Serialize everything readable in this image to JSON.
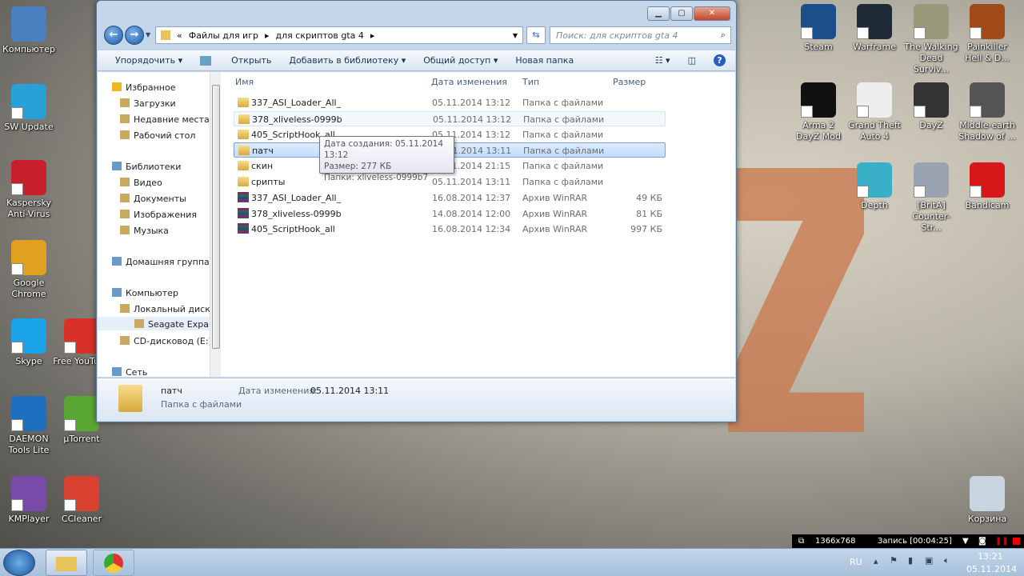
{
  "desktop": {
    "left_icons": [
      {
        "label": "Компьютер",
        "icon": "computer-icon",
        "color": "#4a7fc0"
      },
      {
        "label": "SW Update",
        "icon": "sw-update-icon",
        "color": "#29a0d8"
      },
      {
        "label": "Kaspersky Anti-Virus",
        "icon": "kaspersky-icon",
        "color": "#c8202a"
      },
      {
        "label": "Google Chrome",
        "icon": "chrome-icon",
        "color": "#e0a020"
      },
      {
        "label": "Skype",
        "icon": "skype-icon",
        "color": "#1aa3e6"
      },
      {
        "label": "Free YouTube",
        "icon": "download-icon",
        "color": "#d9302a"
      },
      {
        "label": "DAEMON Tools Lite",
        "icon": "daemon-tools-icon",
        "color": "#1e6fc0"
      },
      {
        "label": "µTorrent",
        "icon": "utorrent-icon",
        "color": "#5aa632"
      },
      {
        "label": "KMPlayer",
        "icon": "kmplayer-icon",
        "color": "#7a4aa8"
      },
      {
        "label": "CCleaner",
        "icon": "ccleaner-icon",
        "color": "#d84030"
      }
    ],
    "right_icons": [
      {
        "label": "Steam",
        "icon": "steam-icon",
        "color": "#1b4f8a"
      },
      {
        "label": "Warframe",
        "icon": "warframe-icon",
        "color": "#1e2a36"
      },
      {
        "label": "The Walking Dead Surviv...",
        "icon": "walking-dead-icon",
        "color": "#9a9a7a"
      },
      {
        "label": "Painkiller Hell & D...",
        "icon": "painkiller-icon",
        "color": "#a04a1a"
      },
      {
        "label": "Arma 2 DayZ Mod",
        "icon": "dayz-mod-icon",
        "color": "#111111"
      },
      {
        "label": "Grand Theft Auto 4",
        "icon": "gta4-icon",
        "color": "#eeeeee"
      },
      {
        "label": "DayZ",
        "icon": "dayz-icon",
        "color": "#333333"
      },
      {
        "label": "Middle-earth Shadow of ...",
        "icon": "shadow-of-mordor-icon",
        "color": "#555555"
      },
      {
        "label": "Depth",
        "icon": "depth-icon",
        "color": "#3ab0c8"
      },
      {
        "label": "[BritA] Counter-Str...",
        "icon": "counter-strike-icon",
        "color": "#9aa4b0"
      },
      {
        "label": "Bandicam",
        "icon": "bandicam-icon",
        "color": "#d81818"
      },
      {
        "label": "Корзина",
        "icon": "recycle-bin-icon",
        "color": "#c8d4e0"
      }
    ]
  },
  "window": {
    "breadcrumb": [
      "«",
      "Файлы для игр",
      "для скриптов gta 4"
    ],
    "search_placeholder": "Поиск: для скриптов gta 4",
    "toolbar": [
      "Упорядочить ▾",
      "Открыть",
      "Добавить в библиотеку ▾",
      "Общий доступ ▾",
      "Новая папка"
    ],
    "nav": [
      {
        "label": "Избранное",
        "level": 0
      },
      {
        "label": "Загрузки",
        "level": 1
      },
      {
        "label": "Недавние места",
        "level": 1
      },
      {
        "label": "Рабочий стол",
        "level": 1
      },
      {
        "label": "Библиотеки",
        "level": 0
      },
      {
        "label": "Видео",
        "level": 1
      },
      {
        "label": "Документы",
        "level": 1
      },
      {
        "label": "Изображения",
        "level": 1
      },
      {
        "label": "Музыка",
        "level": 1
      },
      {
        "label": "Домашняя группа",
        "level": 0
      },
      {
        "label": "Компьютер",
        "level": 0
      },
      {
        "label": "Локальный диск",
        "level": 1
      },
      {
        "label": "Seagate Expansion",
        "level": 1
      },
      {
        "label": "CD-дисковод (E:)",
        "level": 1
      },
      {
        "label": "Сеть",
        "level": 0
      }
    ],
    "columns": [
      "Имя",
      "Дата изменения",
      "Тип",
      "Размер"
    ],
    "files": [
      {
        "name": "337_ASI_Loader_All_",
        "date": "05.11.2014 13:12",
        "type": "Папка с файлами",
        "size": "",
        "kind": "folder"
      },
      {
        "name": "378_xliveless-0999b",
        "date": "05.11.2014 13:12",
        "type": "Папка с файлами",
        "size": "",
        "kind": "folder",
        "state": "hover"
      },
      {
        "name": "405_ScriptHook_all",
        "date": "05.11.2014 13:12",
        "type": "Папка с файлами",
        "size": "",
        "kind": "folder"
      },
      {
        "name": "патч",
        "date": "05.11.2014 13:11",
        "type": "Папка с файлами",
        "size": "",
        "kind": "folder",
        "state": "selected"
      },
      {
        "name": "скин",
        "date": "05.11.2014 21:15",
        "type": "Папка с файлами",
        "size": "",
        "kind": "folder"
      },
      {
        "name": "срипты",
        "date": "05.11.2014 13:11",
        "type": "Папка с файлами",
        "size": "",
        "kind": "folder"
      },
      {
        "name": "337_ASI_Loader_All_",
        "date": "16.08.2014 12:37",
        "type": "Архив WinRAR",
        "size": "49 КБ",
        "kind": "rar"
      },
      {
        "name": "378_xliveless-0999b",
        "date": "14.08.2014 12:00",
        "type": "Архив WinRAR",
        "size": "81 КБ",
        "kind": "rar"
      },
      {
        "name": "405_ScriptHook_all",
        "date": "16.08.2014 12:34",
        "type": "Архив WinRAR",
        "size": "997 КБ",
        "kind": "rar"
      }
    ],
    "tooltip": [
      "Дата создания: 05.11.2014 13:12",
      "Размер: 277 КБ",
      "Папки: xliveless-0999b7"
    ],
    "details": {
      "name": "патч",
      "type": "Папка с файлами",
      "date_label": "Дата изменения:",
      "date": "05.11.2014 13:11"
    }
  },
  "recorder": {
    "resolution": "1366x768",
    "status": "Запись [00:04:25]"
  },
  "tray": {
    "lang": "RU",
    "time": "13:21",
    "date": "05.11.2014"
  }
}
